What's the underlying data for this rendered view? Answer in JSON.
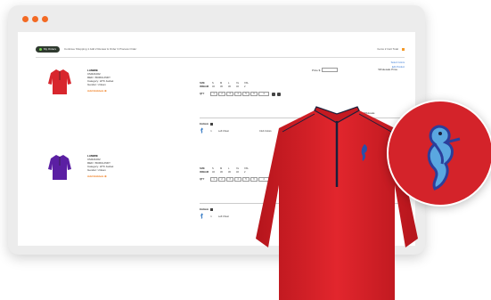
{
  "window": {
    "dots": [
      "#f36a24",
      "#f36a24",
      "#f36a24"
    ]
  },
  "topbar": {
    "pill_label": "My Orders",
    "steps_text": "Continue Shopping 1 Add 2 Review & Order 3 Process Order",
    "right_items": "Items 2 Cart Total"
  },
  "right_links": [
    "Select Colors",
    "Edit Product"
  ],
  "products": [
    {
      "name": "LAMMIE",
      "code": "CM421002",
      "color": "RED / BURGUNDY",
      "category": "Category: HTK Jacket",
      "gender": "Gender: Unisex",
      "add_label": "Add Emblem",
      "price_label": "Price $",
      "wholesale_label": "Wholesale Price",
      "size_label": "SIZE",
      "sizes": [
        "S",
        "M",
        "L",
        "XL",
        "XXL"
      ],
      "inseam_label": "INSEAM",
      "inseam": [
        "32",
        "30",
        "30",
        "32",
        "2"
      ],
      "qty_label": "QTY",
      "qty": [
        "1",
        "2",
        "3",
        "4",
        "5",
        "6",
        "4"
      ],
      "total_price_label": "Total Price",
      "total_wholesale_label": "Total Wholesale",
      "emblem_label": "Emblem",
      "emblem_qty": "1",
      "emblem_location": "Left Chest",
      "emblem_color": "Club Colors",
      "emblem_status": "Edit",
      "total_emblem_label": "Total Emblem Cost",
      "jacket_color": "#d8262d"
    },
    {
      "name": "LAMMIE",
      "code": "CM421002",
      "color": "RED / BURGUNDY",
      "category": "Category: HTK Jacket",
      "gender": "Gender: Unisex",
      "add_label": "Add Emblem",
      "size_label": "SIZE",
      "sizes": [
        "S",
        "M",
        "L",
        "XL",
        "XXL"
      ],
      "inseam_label": "INSEAM",
      "inseam": [
        "32",
        "30",
        "30",
        "32",
        "2"
      ],
      "qty_label": "QTY",
      "qty": [
        "1",
        "2",
        "3",
        "4",
        "5",
        "6",
        "4"
      ],
      "emblem_label": "Emblem",
      "emblem_qty": "1",
      "emblem_location": "Left Chest",
      "jacket_color": "#5b1fa3"
    }
  ],
  "foreground": {
    "jacket_color": "#d62128",
    "piping_color": "#1c1f3a",
    "emblem": "seahorse-icon"
  }
}
